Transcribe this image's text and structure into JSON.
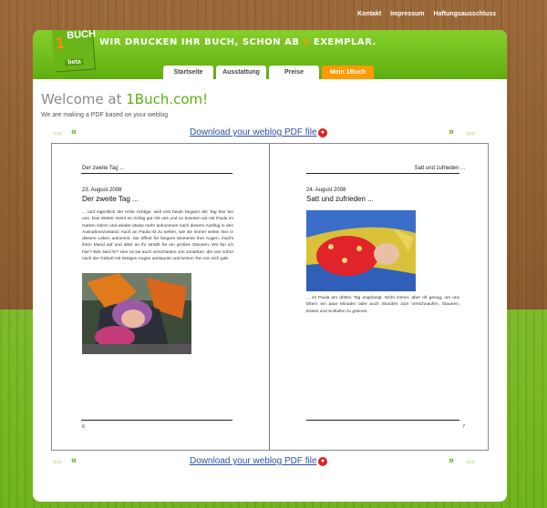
{
  "topnav": {
    "items": [
      "Kontakt",
      "Impressum",
      "Haftungsausschluss"
    ]
  },
  "logo": {
    "numeral": "1",
    "word": "BUCH",
    "tag": "beta"
  },
  "slogan": {
    "before": "Wir drucken Ihr Buch, schon ab ",
    "accent": "1",
    "after": " Exemplar."
  },
  "tabs": [
    {
      "label": "Startseite"
    },
    {
      "label": "Ausstattung"
    },
    {
      "label": "Preise"
    },
    {
      "label": "Mein 1Buch"
    }
  ],
  "welcome": {
    "prefix": "Welcome at ",
    "brand": "1Buch.com!"
  },
  "subtitle": "We are making a PDF based on your weblog",
  "nav": {
    "first": "««",
    "prev": "«",
    "next": "»",
    "last": "»»",
    "download_label": "Download your weblog PDF file"
  },
  "book": {
    "left": {
      "running_head": "Der zweite Tag ...",
      "date": "23. August 2008",
      "heading": "Der zweite Tag ...",
      "body": "... und eigentlich der erste richtige, weil erst heute begann der Tag hier bei uns. Das Wetter meint es richtig gut mit uns und so konnten wir mit Paula im Garten sitzen und wieder etwas mehr ankommen nach diesem Ausflug in den Ausnahmezustand. Auch an Paula ist zu sehen, wie sie immer weiter hier in diesem Leben ankommt. Sie öffnet für längere Momente ihre Augen, macht ihren Mund auf und alles an ihr strahlt für ein großes Staunen. Wo bin ich hier? Wer seid ihr? Hier ist sie auch verschieden von Jonathan, der uns sofort nach der Geburt mit riesigen Augen anstaunte und keinen Ton von sich gab.",
      "page_number": "6"
    },
    "right": {
      "running_head": "Satt und zufrieden ...",
      "date": "24. August 2008",
      "heading": "Satt und zufrieden ...",
      "body": "... ist Paula am dritten Tag angelangt. Nicht immer, aber oft genug, um uns Eltern ein paar Minuten oder auch Stunden zum Verschnaufen, Staunen, Essen und Schlafen zu gönnen.",
      "page_number": "7"
    }
  }
}
